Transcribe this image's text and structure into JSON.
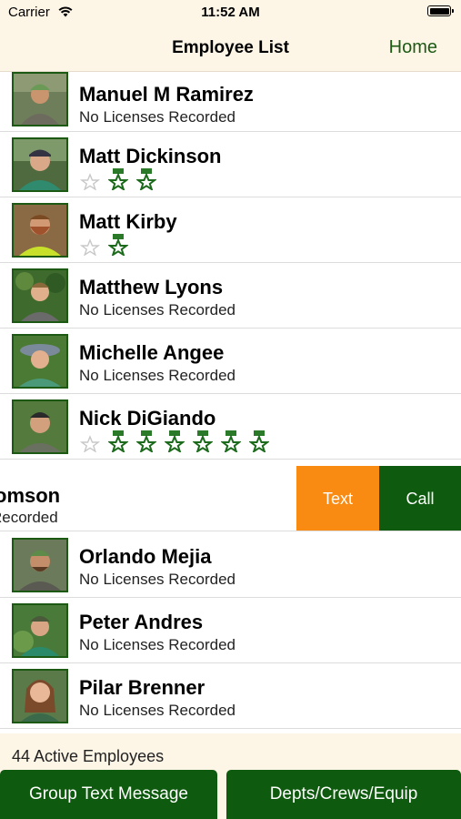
{
  "status": {
    "carrier": "Carrier",
    "time": "11:52 AM"
  },
  "nav": {
    "title": "Employee List",
    "home": "Home"
  },
  "colors": {
    "brand_green": "#0e5a0e",
    "text_action": "#f98a12",
    "background": "#fdf5e6"
  },
  "employees": [
    {
      "name": "Manuel M Ramirez",
      "subtitle": "No Licenses Recorded"
    },
    {
      "name": "Matt Dickinson",
      "licenses": [
        "inactive",
        "active",
        "active"
      ]
    },
    {
      "name": "Matt Kirby",
      "licenses": [
        "inactive",
        "active"
      ]
    },
    {
      "name": "Matthew Lyons",
      "subtitle": "No Licenses Recorded"
    },
    {
      "name": "Michelle Angee",
      "subtitle": "No Licenses Recorded"
    },
    {
      "name": "Nick DiGiando",
      "licenses": [
        "inactive",
        "active",
        "active",
        "active",
        "active",
        "active",
        "active"
      ]
    },
    {
      "name": "omson",
      "subtitle": "Recorded"
    },
    {
      "name": "Orlando Mejia",
      "subtitle": "No Licenses Recorded"
    },
    {
      "name": "Peter Andres",
      "subtitle": "No Licenses Recorded"
    },
    {
      "name": "Pilar Brenner",
      "subtitle": "No Licenses Recorded"
    }
  ],
  "swipe_actions": {
    "text": "Text",
    "call": "Call"
  },
  "footer": {
    "count": "44 Active Employees",
    "group_text": "Group Text Message",
    "depts": "Depts/Crews/Equip"
  }
}
